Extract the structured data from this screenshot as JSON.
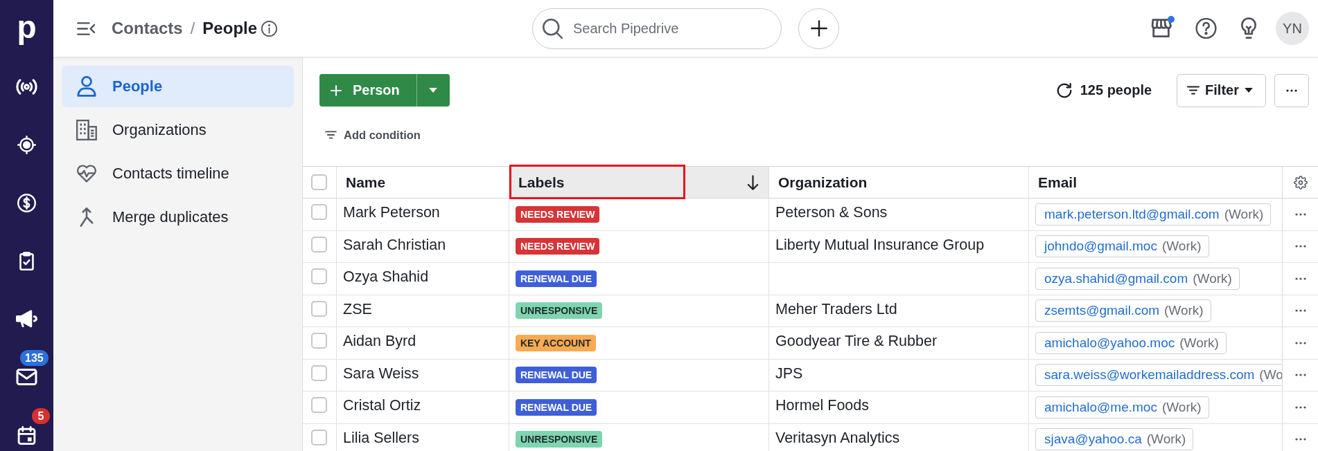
{
  "nav_rail": {
    "logo": "p",
    "mail_badge": "135",
    "calendar_badge": "5"
  },
  "topbar": {
    "breadcrumb": {
      "parent": "Contacts",
      "separator": "/",
      "current": "People"
    },
    "search": {
      "placeholder": "Search Pipedrive"
    },
    "marketplace": {
      "notification": true
    },
    "avatar": "YN"
  },
  "sidebar": {
    "items": [
      {
        "kind": "people",
        "label": "People",
        "selected": true
      },
      {
        "kind": "organizations",
        "label": "Organizations",
        "selected": false
      },
      {
        "kind": "timeline",
        "label": "Contacts timeline",
        "selected": false
      },
      {
        "kind": "merge",
        "label": "Merge duplicates",
        "selected": false
      }
    ]
  },
  "toolbar": {
    "add_button": "Person",
    "add_condition": "Add condition",
    "count": "125 people",
    "filter_button": "Filter"
  },
  "table": {
    "select_all": {
      "checked": false
    },
    "columns": [
      {
        "label": "Name",
        "sorted": false,
        "highlighted": false
      },
      {
        "label": "Labels",
        "sorted": true,
        "highlighted": true
      },
      {
        "label": "Organization",
        "sorted": false,
        "highlighted": false
      },
      {
        "label": "Email",
        "sorted": false,
        "highlighted": false
      }
    ],
    "rows": [
      {
        "checked": false,
        "name": "Mark Peterson",
        "label": {
          "text": "NEEDS REVIEW",
          "color": "#d63436"
        },
        "organization": "Peterson & Sons",
        "email": {
          "address": "mark.peterson.ltd@gmail.com",
          "type": "(Work)"
        }
      },
      {
        "checked": false,
        "name": "Sarah Christian",
        "label": {
          "text": "NEEDS REVIEW",
          "color": "#d63436"
        },
        "organization": "Liberty Mutual Insurance Group",
        "email": {
          "address": "johndo@gmail.moc",
          "type": "(Work)"
        }
      },
      {
        "checked": false,
        "name": "Ozya Shahid",
        "label": {
          "text": "RENEWAL DUE",
          "color": "#3f5fd8"
        },
        "email": {
          "address": "ozya.shahid@gmail.com",
          "type": "(Work)"
        }
      },
      {
        "checked": false,
        "name": "ZSE",
        "label": {
          "text": "UNRESPONSIVE",
          "color": "#7ed5b0"
        },
        "organization": "Meher Traders Ltd",
        "email": {
          "address": "zsemts@gmail.com",
          "type": "(Work)"
        }
      },
      {
        "checked": false,
        "name": "Aidan Byrd",
        "label": {
          "text": "KEY ACCOUNT",
          "color": "#fbaa52"
        },
        "organization": "Goodyear Tire & Rubber",
        "email": {
          "address": "amichalo@yahoo.moc",
          "type": "(Work)"
        }
      },
      {
        "checked": false,
        "name": "Sara Weiss",
        "label": {
          "text": "RENEWAL DUE",
          "color": "#3f5fd8"
        },
        "organization": "JPS",
        "email": {
          "address": "sara.weiss@workemailaddress.com",
          "type": "(Wo"
        }
      },
      {
        "checked": false,
        "name": "Cristal Ortiz",
        "label": {
          "text": "RENEWAL DUE",
          "color": "#3f5fd8"
        },
        "organization": "Hormel Foods",
        "email": {
          "address": "amichalo@me.moc",
          "type": "(Work)"
        }
      },
      {
        "checked": false,
        "name": "Lilia Sellers",
        "label": {
          "text": "UNRESPONSIVE",
          "color": "#7ed5b0"
        },
        "organization": "Veritasyn Analytics",
        "email": {
          "address": "sjava@yahoo.ca",
          "type": "(Work)"
        }
      }
    ]
  }
}
